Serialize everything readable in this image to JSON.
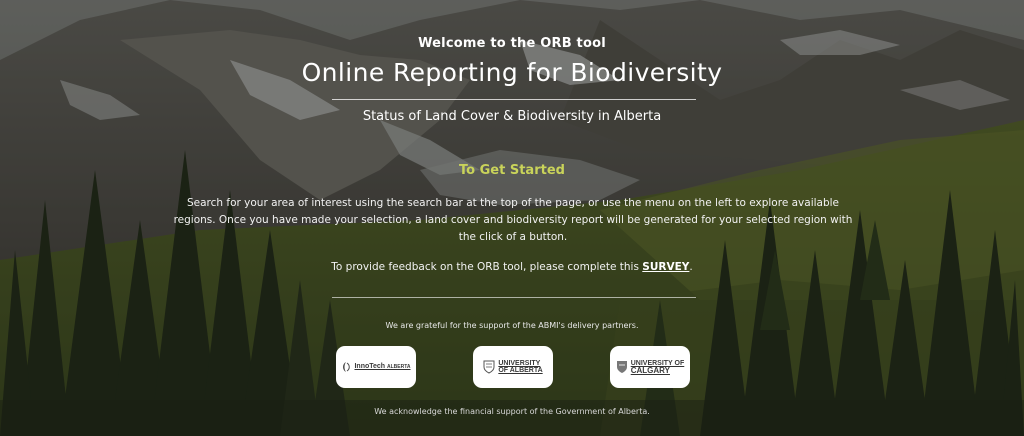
{
  "header": {
    "welcome": "Welcome to the ORB tool",
    "title": "Online Reporting for Biodiversity",
    "subtitle": "Status of Land Cover & Biodiversity in Alberta"
  },
  "getting_started": {
    "heading": "To Get Started",
    "instructions": "Search for your area of interest using the search bar at the top of the page, or use the menu on the left to explore available regions. Once you have made your selection, a land cover and biodiversity report will be generated for your selected region with the click of a button.",
    "feedback_prefix": "To provide feedback on the ORB tool, please complete this ",
    "feedback_link": "SURVEY",
    "feedback_suffix": "."
  },
  "partners": {
    "grateful": "We are grateful for the support of the ABMI's delivery partners.",
    "logos": [
      {
        "name": "InnoTech",
        "line1": "InnoTech",
        "line2": "ALBERTA"
      },
      {
        "name": "University of Alberta",
        "line1": "UNIVERSITY",
        "line2": "OF ALBERTA"
      },
      {
        "name": "University of Calgary",
        "line1": "UNIVERSITY OF",
        "line2": "CALGARY"
      }
    ],
    "acknowledge": "We acknowledge the financial support of the Government of Alberta."
  },
  "colors": {
    "accent": "#c9d35a",
    "text": "#ffffff"
  }
}
